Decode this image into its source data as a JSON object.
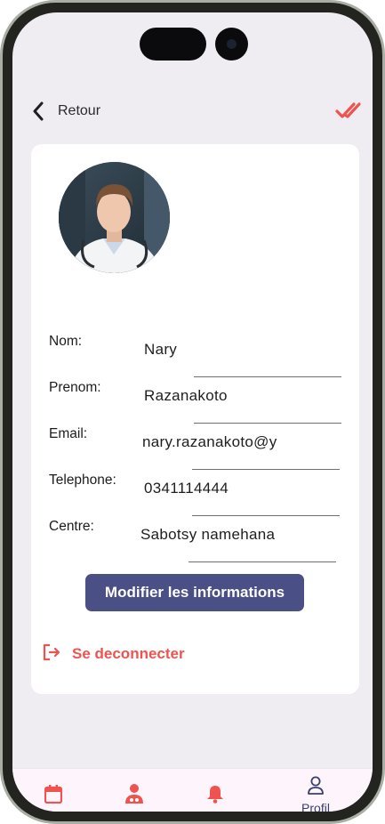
{
  "header": {
    "back_label": "Retour",
    "back_icon": "chevron-left-icon",
    "confirm_icon": "double-check-icon"
  },
  "profile": {
    "avatar_alt": "doctor-avatar",
    "fields": [
      {
        "label": "Nom:",
        "value": "Nary"
      },
      {
        "label": "Prenom:",
        "value": "Razanakoto"
      },
      {
        "label": "Email:",
        "value": "nary.razanakoto@y"
      },
      {
        "label": "Telephone:",
        "value": "0341114444"
      },
      {
        "label": "Centre:",
        "value": "Sabotsy namehana"
      }
    ],
    "edit_button": "Modifier les informations",
    "logout_label": "Se deconnecter"
  },
  "tabbar": {
    "tabs": [
      {
        "icon": "calendar-icon",
        "label": ""
      },
      {
        "icon": "doctor-icon",
        "label": ""
      },
      {
        "icon": "bell-icon",
        "label": ""
      },
      {
        "icon": "user-icon",
        "label": "Profil"
      }
    ]
  },
  "colors": {
    "accent": "#ef5350",
    "primary": "#4a4f86",
    "background": "#efedf2"
  }
}
